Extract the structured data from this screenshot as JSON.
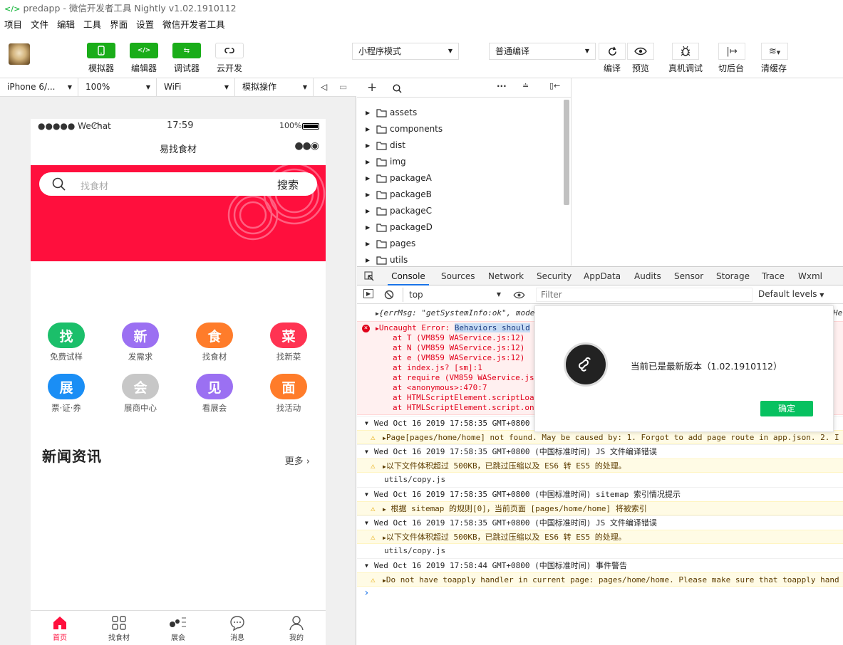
{
  "window": {
    "title": "predapp - 微信开发者工具 Nightly v1.02.1910112"
  },
  "menu": [
    "项目",
    "文件",
    "编辑",
    "工具",
    "界面",
    "设置",
    "微信开发者工具"
  ],
  "toolbar": {
    "simulator": "模拟器",
    "editor": "编辑器",
    "debugger": "调试器",
    "cloud": "云开发",
    "mode_select": "小程序模式",
    "compile_select": "普通编译",
    "compile": "编译",
    "preview": "预览",
    "remote_debug": "真机调试",
    "background": "切后台",
    "clear_cache": "清缓存"
  },
  "simbar": {
    "device": "iPhone 6/...",
    "zoom": "100%",
    "network": "WiFi",
    "operation": "模拟操作"
  },
  "phone": {
    "carrier": "●●●●● WeChat",
    "time": "17:59",
    "battery": "100%",
    "nav_title": "易找食材",
    "search_placeholder": "找食材",
    "search_button": "搜索",
    "grid": [
      {
        "char": "找",
        "label": "免费试样",
        "color": "#1bbf6a"
      },
      {
        "char": "新",
        "label": "发需求",
        "color": "#9b70f2"
      },
      {
        "char": "食",
        "label": "找食材",
        "color": "#ff7c2a"
      },
      {
        "char": "菜",
        "label": "找新菜",
        "color": "#ff3352"
      },
      {
        "char": "展",
        "label": "票·证·券",
        "color": "#1a8ef5"
      },
      {
        "char": "会",
        "label": "展商中心",
        "color": "#c7c7c7"
      },
      {
        "char": "见",
        "label": "看展会",
        "color": "#9b70f2"
      },
      {
        "char": "面",
        "label": "找活动",
        "color": "#ff7c2a"
      }
    ],
    "news_title": "新闻资讯",
    "more": "更多",
    "tabs": [
      "首页",
      "找食材",
      "展会",
      "消息",
      "我的"
    ],
    "accent": "#ff0f3d"
  },
  "files": [
    "assets",
    "components",
    "dist",
    "img",
    "packageA",
    "packageB",
    "packageC",
    "packageD",
    "pages",
    "utils"
  ],
  "devtools": {
    "tabs": [
      "Console",
      "Sources",
      "Network",
      "Security",
      "AppData",
      "Audits",
      "Sensor",
      "Storage",
      "Trace",
      "Wxml"
    ],
    "context": "top",
    "filter_placeholder": "Filter",
    "levels": "Default levels"
  },
  "console": {
    "line1": "{errMsg: \"getSystemInfo:ok\", model",
    "line1_tail": "He",
    "error_prefix": "Uncaught Error: ",
    "error_highlight": "Behaviors should",
    "stack": [
      "at T (VM859 WAService.js:12)",
      "at N (VM859 WAService.js:12)",
      "at e (VM859 WAService.js:12)",
      "at index.js? [sm]:1",
      "at require (VM859 WAService.js",
      "at <anonymous>:470:7",
      "at HTMLScriptElement.scriptLoa",
      "at HTMLScriptElement.script.on"
    ],
    "g1": "Wed Oct 16 2019 17:58:35 GMT+0800",
    "w1": "Page[pages/home/home] not found. May be caused by: 1. Forgot to add page route in app.json. 2. I",
    "g2": "Wed Oct 16 2019 17:58:35 GMT+0800 (中国标准时间) JS 文件编译错误",
    "w2": "以下文件体积超过 500KB，已跳过压缩以及 ES6 转 ES5 的处理。",
    "f2": "utils/copy.js",
    "g3": "Wed Oct 16 2019 17:58:35 GMT+0800 (中国标准时间) sitemap 索引情况提示",
    "w3": " 根据 sitemap 的规则[0]，当前页面 [pages/home/home] 将被索引",
    "g4": "Wed Oct 16 2019 17:58:35 GMT+0800 (中国标准时间) JS 文件编译错误",
    "w4": "以下文件体积超过 500KB，已跳过压缩以及 ES6 转 ES5 的处理。",
    "f4": "utils/copy.js",
    "g5": "Wed Oct 16 2019 17:58:44 GMT+0800 (中国标准时间) 事件警告",
    "w5": "Do not have toapply handler in current page: pages/home/home. Please make sure that toapply hand",
    "prompt": "›"
  },
  "dialog": {
    "message": "当前已是最新版本（1.02.1910112）",
    "ok": "确定"
  }
}
